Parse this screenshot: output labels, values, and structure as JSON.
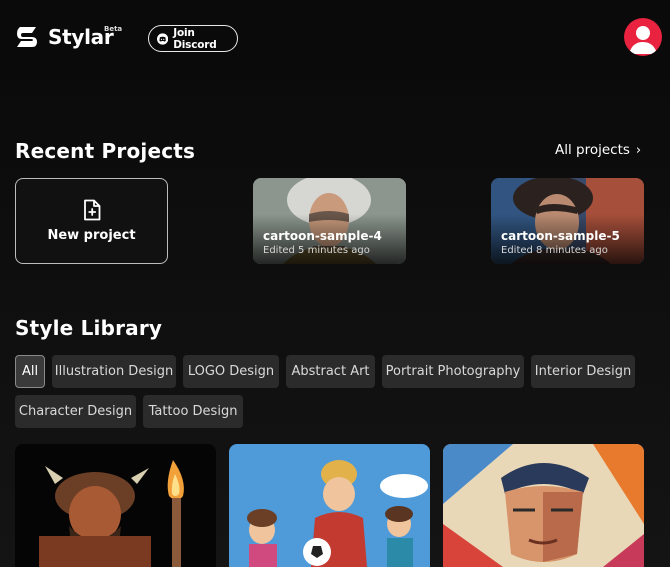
{
  "header": {
    "brand": "Stylar",
    "beta_label": "Beta",
    "discord_label": "Join Discord"
  },
  "recent": {
    "title": "Recent Projects",
    "all_projects_label": "All projects",
    "new_project_label": "New project",
    "projects": [
      {
        "name": "cartoon-sample-4",
        "edited": "Edited 5 minutes ago"
      },
      {
        "name": "cartoon-sample-5",
        "edited": "Edited 8 minutes ago"
      }
    ]
  },
  "library": {
    "title": "Style Library",
    "filters": [
      "All",
      "Illustration Design",
      "LOGO Design",
      "Abstract Art",
      "Portrait Photography",
      "Interior Design",
      "Character Design",
      "Tattoo Design"
    ],
    "active_filter": "All"
  },
  "colors": {
    "background": "#0d0d0d",
    "chip_bg": "#2b2b2b",
    "avatar": "#e8223f",
    "text": "#ffffff"
  },
  "icons": {
    "logo": "stylar-s-logo",
    "discord": "discord-icon",
    "avatar": "user-avatar-icon",
    "new_project": "file-plus-icon",
    "all_projects_arrow": "chevron-right-icon"
  }
}
